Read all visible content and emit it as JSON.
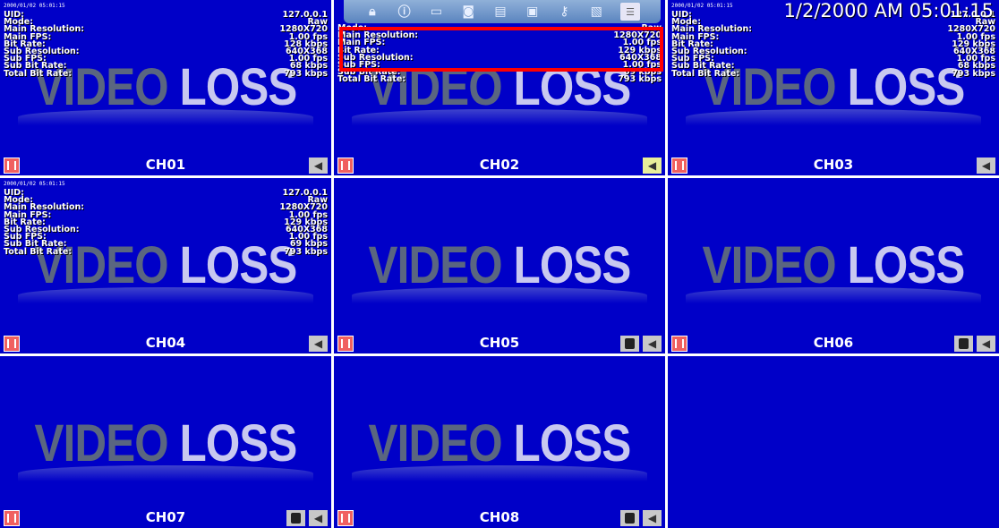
{
  "video_loss": {
    "word1": "VIDEO",
    "word2": "LOSS"
  },
  "timestamp": "2000/01/02 05:01:15",
  "big_datetime": "1/2/2000 AM 05:01:15",
  "labels": {
    "uid": "UID:",
    "mode": "Mode:",
    "main_res": "Main Resolution:",
    "main_fps": "Main FPS:",
    "bit_rate": "Bit Rate:",
    "sub_res": "Sub Resolution:",
    "sub_fps": "Sub FPS:",
    "sub_bit_rate": "Sub Bit Rate:",
    "total_bit_rate": "Total Bit Rate:"
  },
  "channels": [
    {
      "name": "CH01",
      "info": {
        "uid": "127.0.0.1",
        "mode": "Raw",
        "main_res": "1280X720",
        "main_fps": "1.00 fps",
        "bit_rate": "128 kbps",
        "sub_res": "640X368",
        "sub_fps": "1.00 fps",
        "sub_bit_rate": "68 kbps",
        "total_bit_rate": "793 kbps"
      }
    },
    {
      "name": "CH02",
      "info": {
        "uid": "",
        "mode": "Raw",
        "main_res": "1280X720",
        "main_fps": "1.00 fps",
        "bit_rate": "129 kbps",
        "sub_res": "640X368",
        "sub_fps": "1.00 fps",
        "sub_bit_rate": "69 kbps",
        "total_bit_rate": "793 kbps"
      }
    },
    {
      "name": "CH03",
      "info": {
        "uid": "127.0.0.1",
        "mode": "Raw",
        "main_res": "1280X720",
        "main_fps": "1.00 fps",
        "bit_rate": "129 kbps",
        "sub_res": "640X368",
        "sub_fps": "1.00 fps",
        "sub_bit_rate": "68 kbps",
        "total_bit_rate": "793 kbps"
      }
    },
    {
      "name": "CH04",
      "info": {
        "uid": "127.0.0.1",
        "mode": "Raw",
        "main_res": "1280X720",
        "main_fps": "1.00 fps",
        "bit_rate": "129 kbps",
        "sub_res": "640X368",
        "sub_fps": "1.00 fps",
        "sub_bit_rate": "69 kbps",
        "total_bit_rate": "793 kbps"
      }
    },
    {
      "name": "CH05"
    },
    {
      "name": "CH06"
    },
    {
      "name": "CH07"
    },
    {
      "name": "CH08"
    }
  ],
  "toolbar_icons": [
    "lock-icon",
    "info-icon",
    "monitor-icon",
    "camera-icon",
    "film-icon",
    "screen-icon",
    "keys-icon",
    "image-icon",
    "list-icon"
  ],
  "colors": {
    "tile_bg": "#0000c8",
    "highlight": "#ff0000",
    "record_icon": "#f06060",
    "speaker_active": "#e8ee9a"
  }
}
